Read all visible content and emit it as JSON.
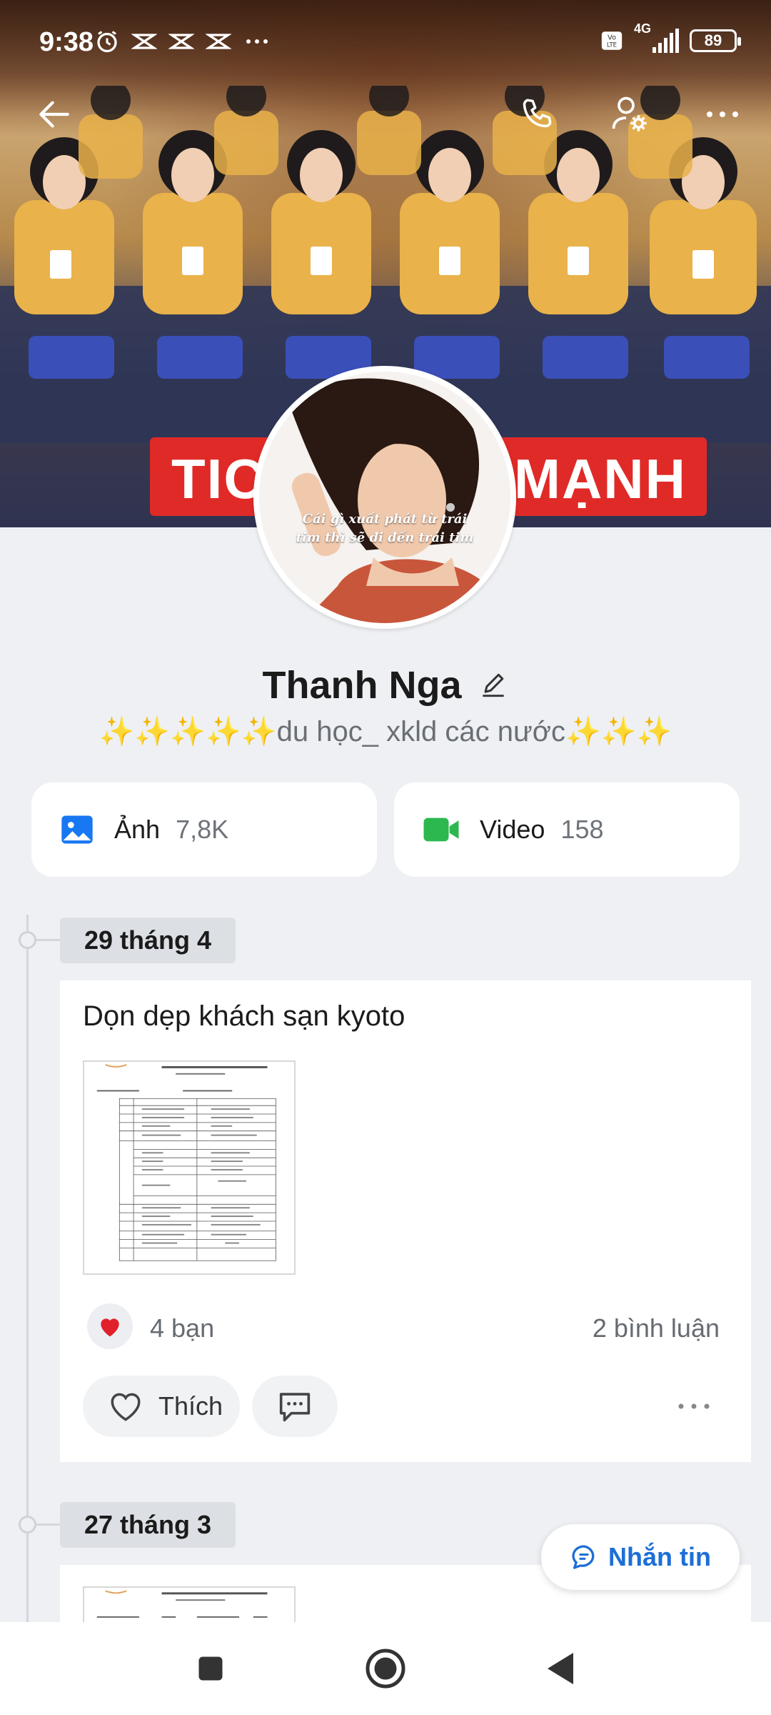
{
  "status_bar": {
    "time": "9:38",
    "network": "4G",
    "battery": "89",
    "icons_left": [
      "alarm-icon",
      "notification-icon",
      "notification-icon",
      "notification-icon",
      "more-notifications-icon"
    ],
    "icons_right": [
      "volte-icon",
      "signal-icon",
      "battery-icon"
    ]
  },
  "cover": {
    "banner_left": "TIC",
    "banner_right": "MẠNH"
  },
  "top_bar": {
    "icons": [
      "back-arrow-icon",
      "phone-icon",
      "user-settings-icon",
      "more-icon"
    ]
  },
  "avatar": {
    "quote_line1": "Cái gì xuất phát từ trái",
    "quote_line2": "tim thì sẽ đi đến trái tim"
  },
  "profile": {
    "name": "Thanh Nga",
    "bio_prefix": "✨✨✨✨✨",
    "bio_text": "du học_ xkld các nước",
    "bio_suffix": "✨✨✨"
  },
  "media": {
    "photos_label": "Ảnh",
    "photos_count": "7,8K",
    "videos_label": "Video",
    "videos_count": "158",
    "photos_icon": "photo-icon",
    "videos_icon": "video-camera-icon",
    "photos_color": "#1877f2",
    "videos_color": "#2cb84f"
  },
  "timeline": [
    {
      "date": "29 tháng 4",
      "title": "Dọn dẹp khách sạn kyoto",
      "reactions": "4 bạn",
      "comments": "2 bình luận",
      "like_label": "Thích"
    },
    {
      "date": "27 tháng 3"
    }
  ],
  "message_button": {
    "label": "Nhắn tin",
    "color": "#1d6fd6"
  },
  "nav_bar": {
    "icons": [
      "recents-square-icon",
      "home-circle-icon",
      "back-triangle-icon"
    ]
  }
}
